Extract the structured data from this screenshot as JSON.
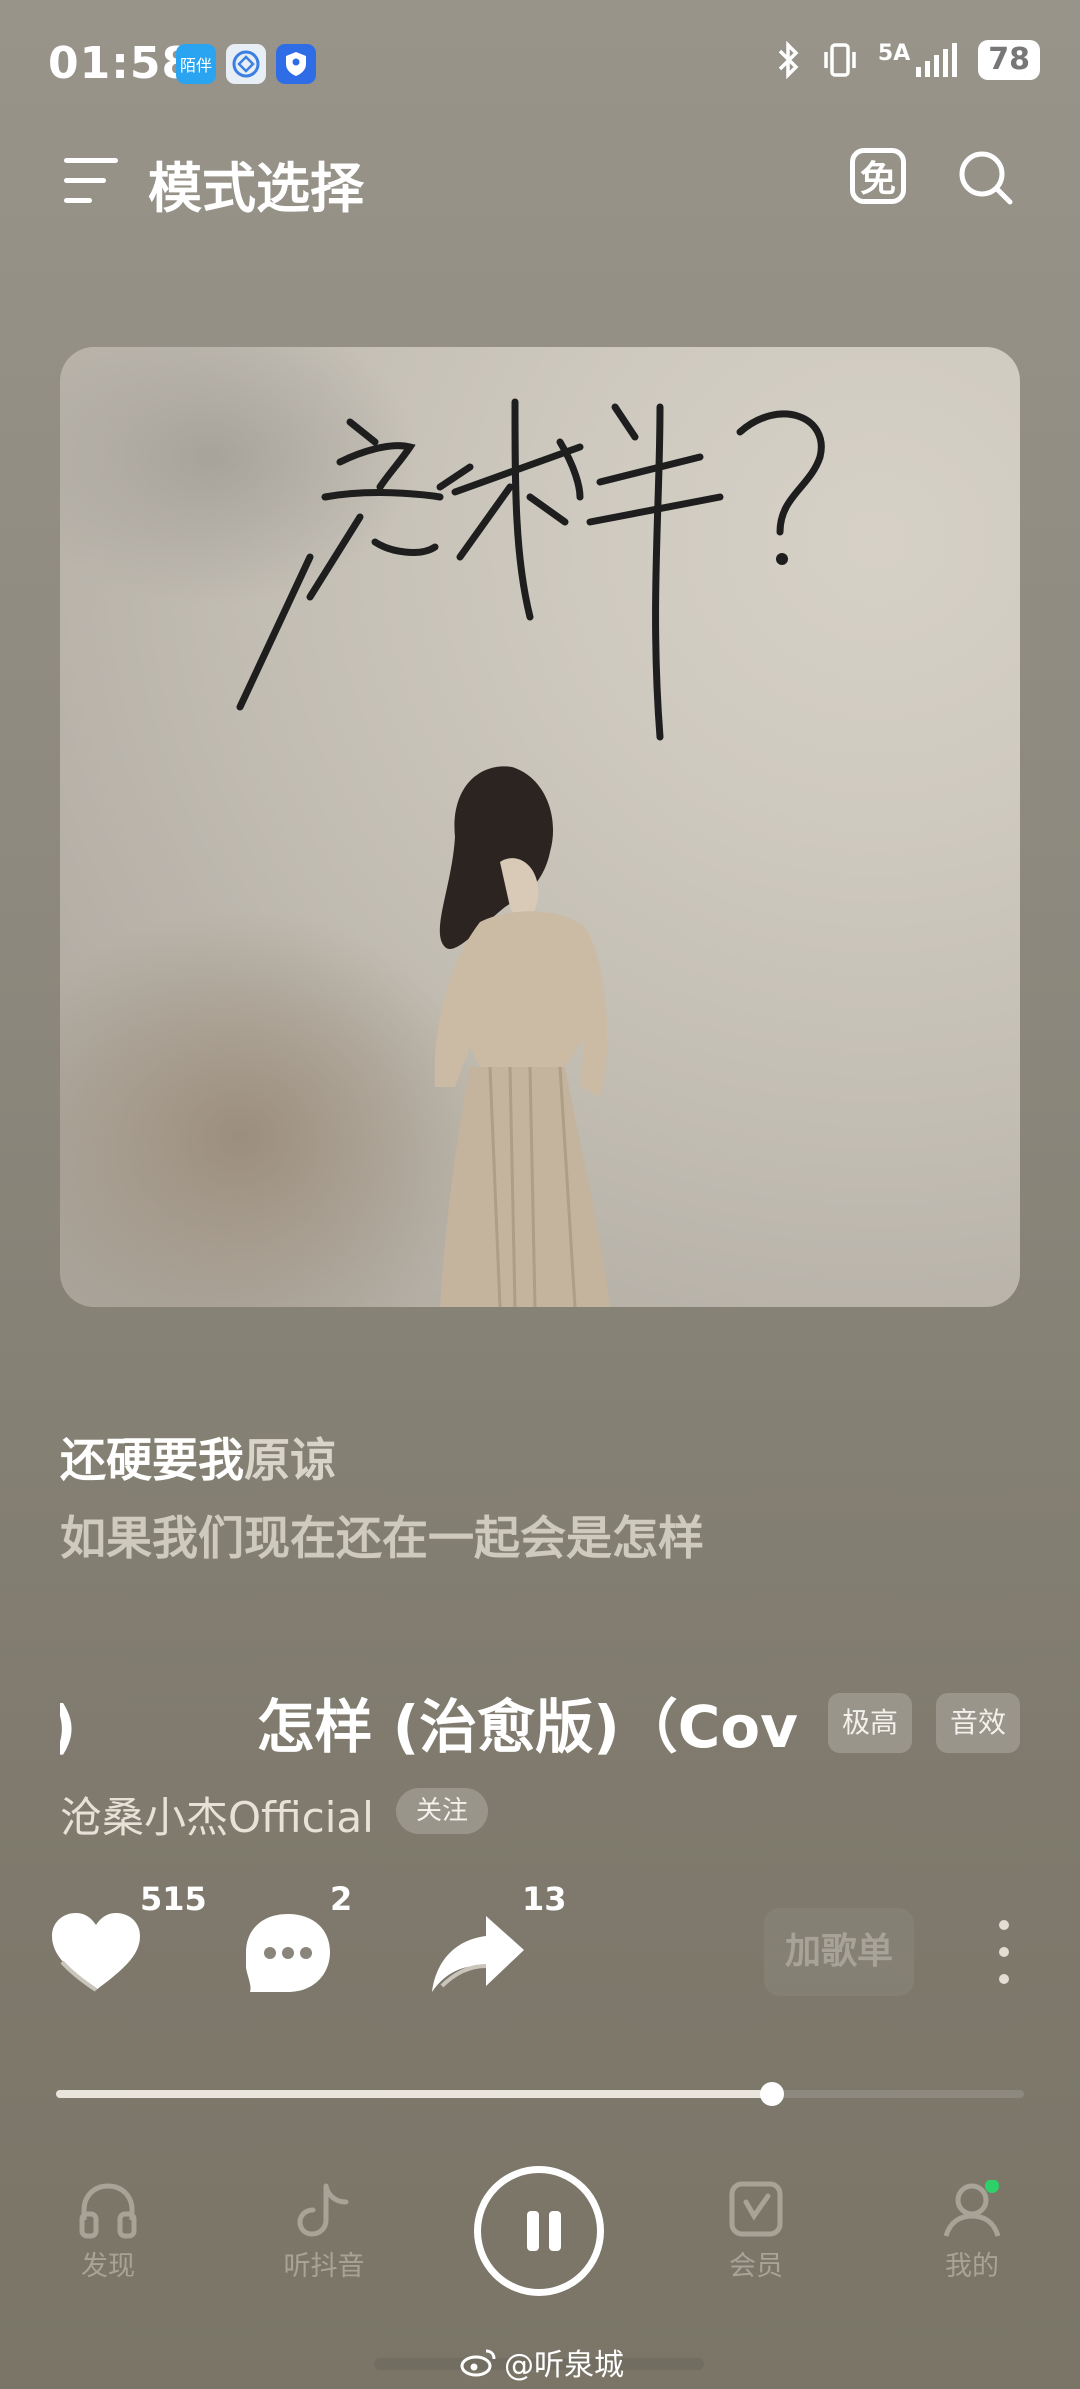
{
  "status_bar": {
    "time": "01:58",
    "app_icon_1": "陌伴",
    "network": "5A",
    "battery": "78"
  },
  "header": {
    "title": "模式选择",
    "free_label": "免"
  },
  "cover": {
    "title_text": "怎样?"
  },
  "lyrics": {
    "current_a": "还硬要我",
    "current_b": "原谅",
    "next": "如果我们现在还在一起会是怎样"
  },
  "song": {
    "lead_fragment": ")",
    "title": "怎样 (治愈版)（Cov",
    "quality_tag": "极高",
    "effect_tag": "音效",
    "artist": "沧桑小杰Official",
    "follow_label": "关注"
  },
  "actions": {
    "likes": "515",
    "comments": "2",
    "shares": "13",
    "add_playlist_label": "加歌单"
  },
  "progress": {
    "fraction": 0.74
  },
  "bottom_nav": {
    "items": [
      {
        "label": "发现",
        "icon": "headphones-icon"
      },
      {
        "label": "听抖音",
        "icon": "douyin-icon"
      },
      {
        "label": "会员",
        "icon": "vip-icon"
      },
      {
        "label": "我的",
        "icon": "profile-icon"
      }
    ]
  },
  "watermark": "@听泉城",
  "colors": {
    "background": "#8c887d",
    "accent_dot": "#2fd06a"
  }
}
